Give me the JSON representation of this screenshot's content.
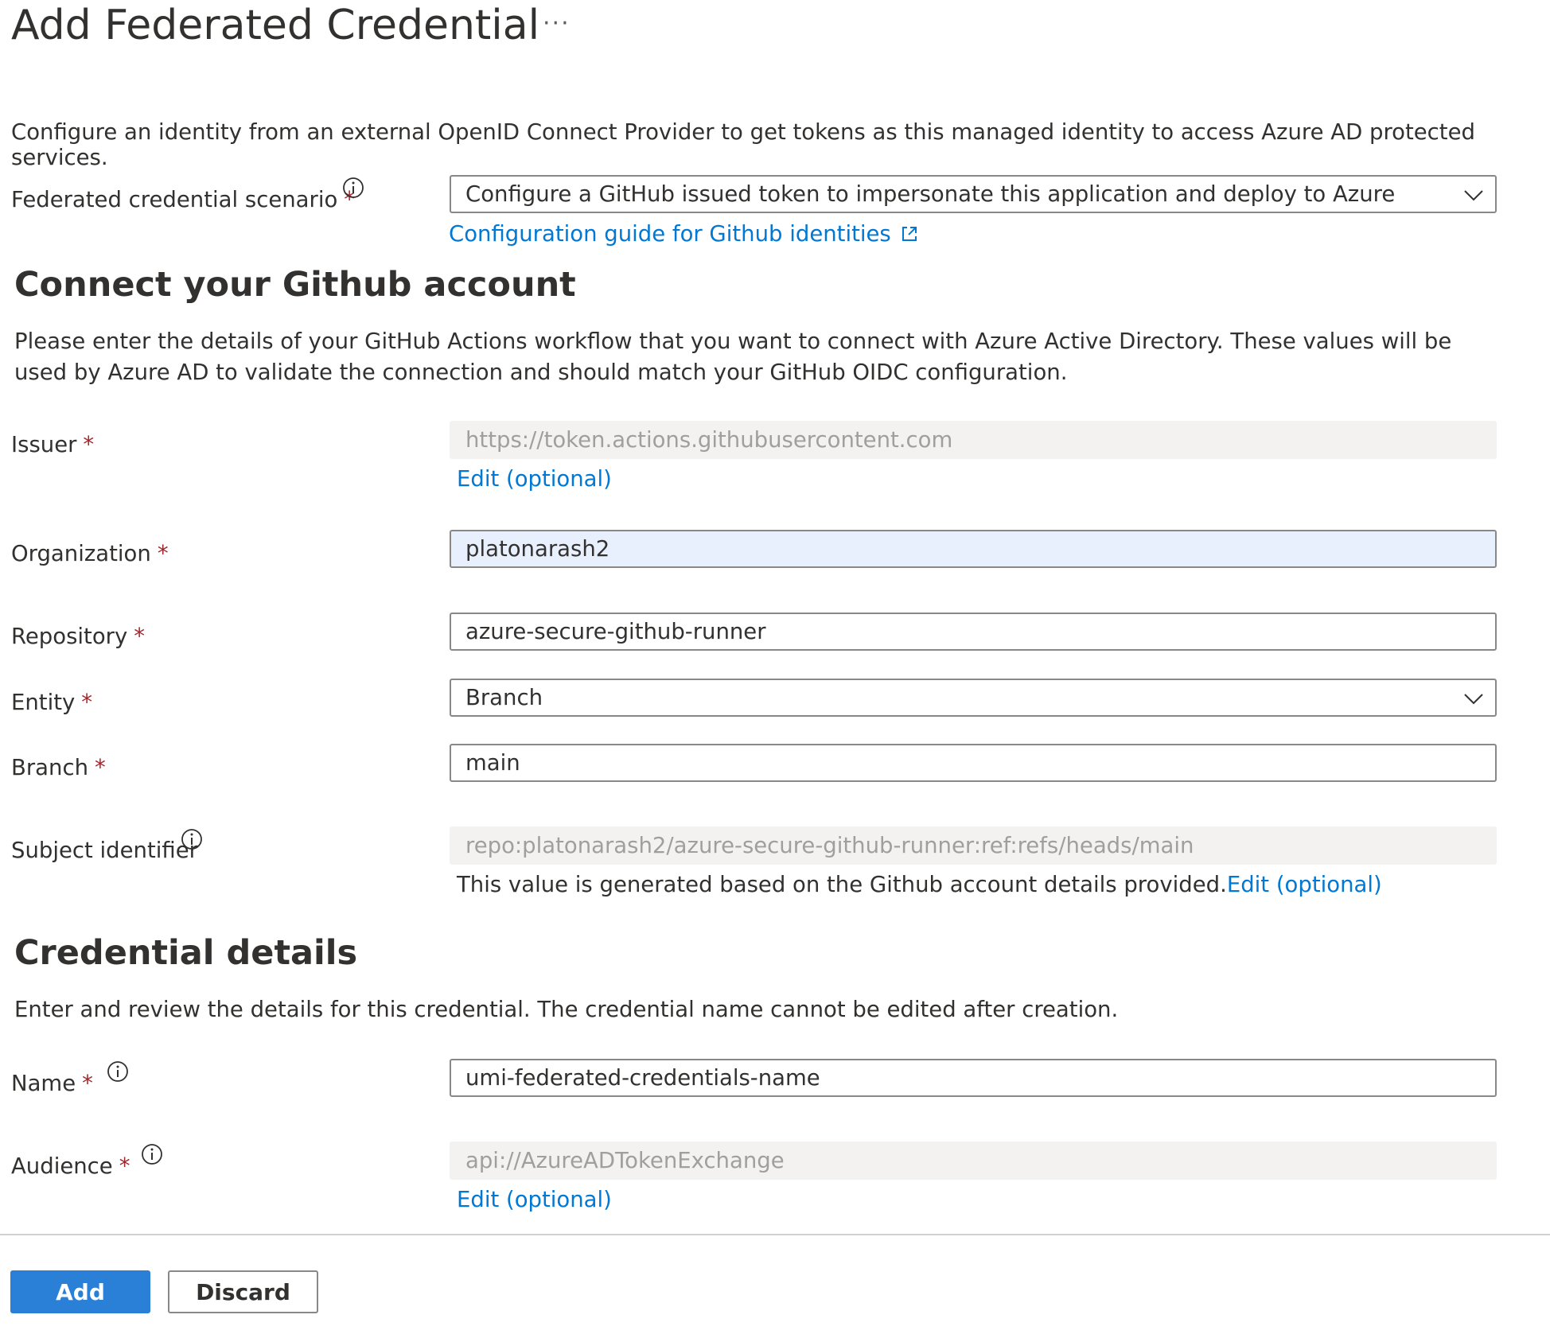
{
  "header": {
    "title": "Add Federated Credential",
    "more_label": "···"
  },
  "description": "Configure an identity from an external OpenID Connect Provider to get tokens as this managed identity to access Azure AD protected services.",
  "scenario": {
    "label": "Federated credential scenario",
    "required_mark": "*",
    "value": "Configure a GitHub issued token to impersonate this application and deploy to Azure",
    "guide_link": "Configuration guide for Github identities"
  },
  "github_section": {
    "heading": "Connect your Github account",
    "description": "Please enter the details of your GitHub Actions workflow that you want to connect with Azure Active Directory. These values will be used by Azure AD to validate the connection and should match your GitHub OIDC configuration."
  },
  "issuer": {
    "label": "Issuer",
    "placeholder": "https://token.actions.githubusercontent.com",
    "edit_link": "Edit (optional)"
  },
  "organization": {
    "label": "Organization",
    "value": "platonarash2"
  },
  "repository": {
    "label": "Repository",
    "value": "azure-secure-github-runner"
  },
  "entity": {
    "label": "Entity",
    "value": "Branch"
  },
  "branch": {
    "label": "Branch",
    "value": "main"
  },
  "subject": {
    "label": "Subject identifier",
    "placeholder": "repo:platonarash2/azure-secure-github-runner:ref:refs/heads/main",
    "helper": "This value is generated based on the Github account details provided.",
    "edit_link": "Edit (optional)"
  },
  "credential_section": {
    "heading": "Credential details",
    "description": "Enter and review the details for this credential. The credential name cannot be edited after creation."
  },
  "name": {
    "label": "Name",
    "value": "umi-federated-credentials-name"
  },
  "audience": {
    "label": "Audience",
    "placeholder": "api://AzureADTokenExchange",
    "edit_link": "Edit (optional)"
  },
  "footer": {
    "add_label": "Add",
    "discard_label": "Discard"
  },
  "colors": {
    "accent": "#0078d4",
    "primary_button": "#2a7fd6",
    "required": "#a4262c",
    "disabled_bg": "#f3f2f1",
    "autofill_bg": "#e8f0fe"
  }
}
